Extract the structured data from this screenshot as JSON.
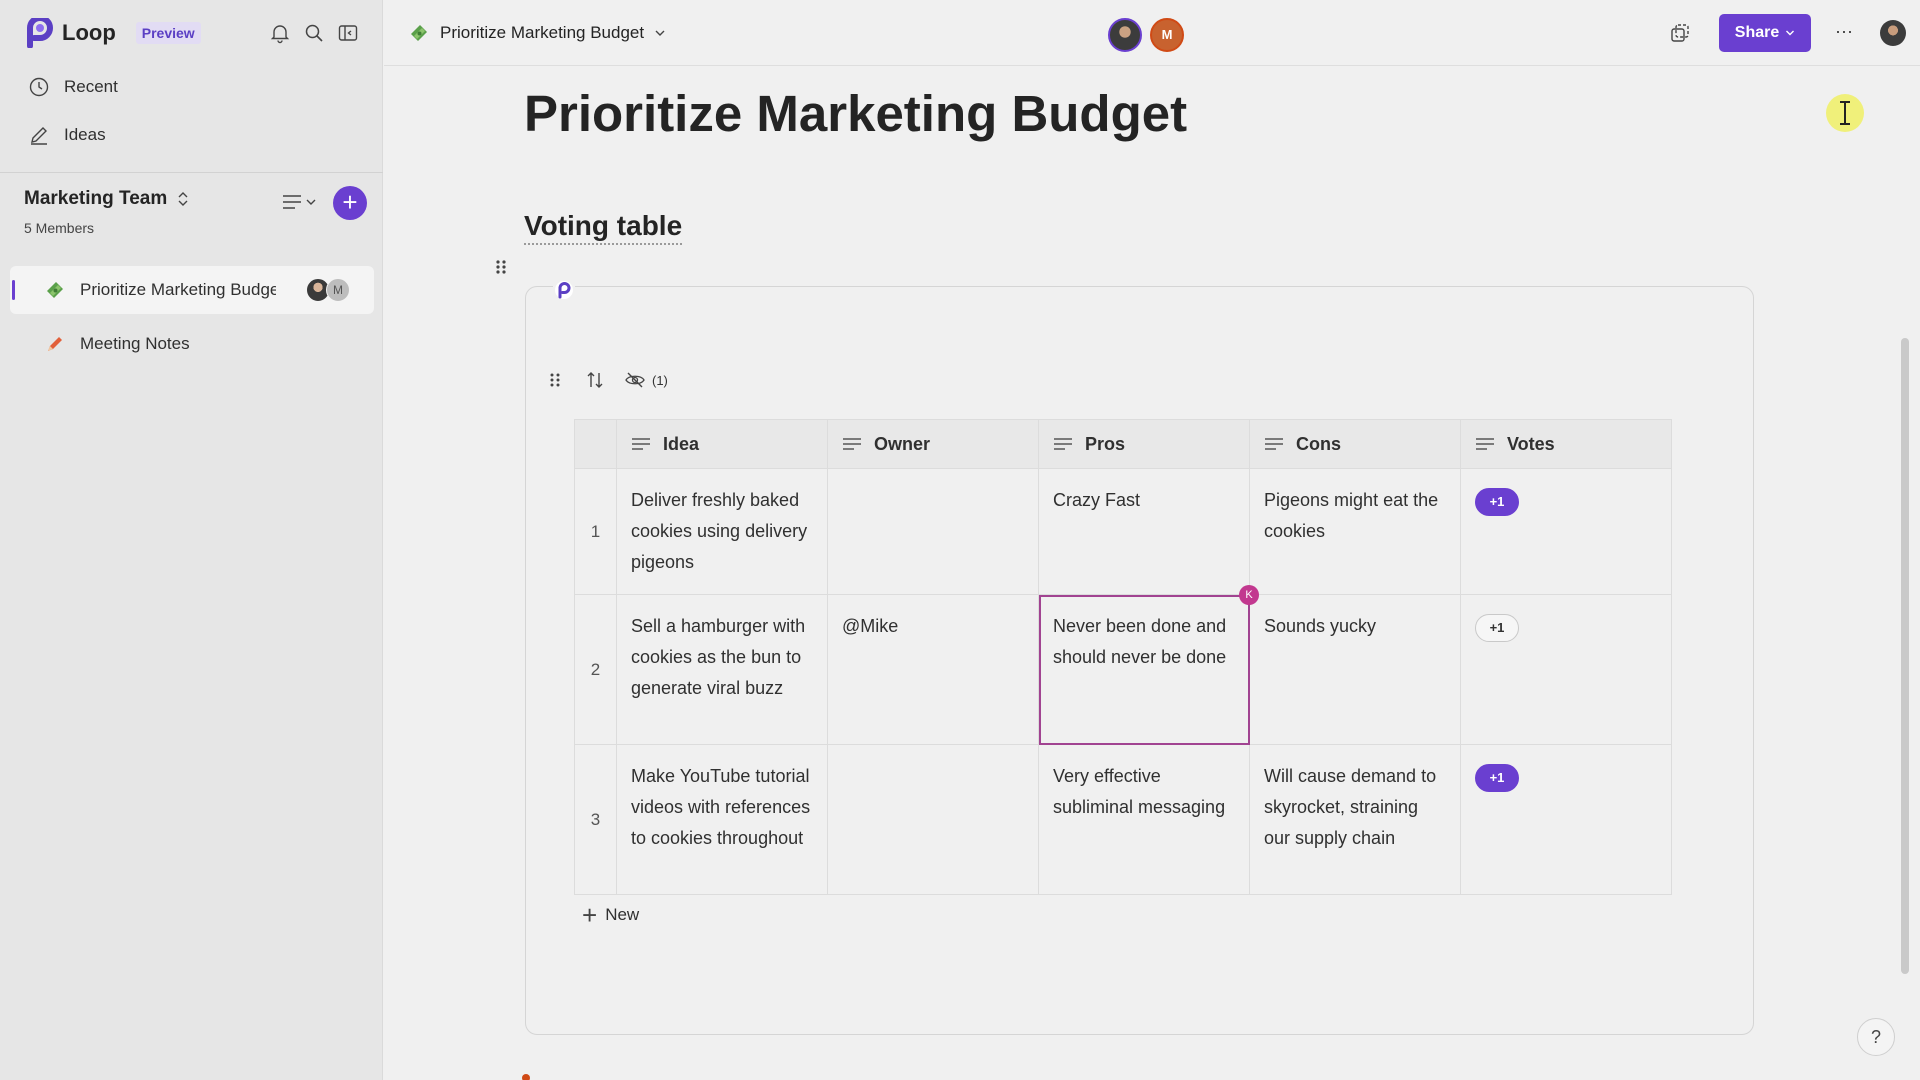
{
  "app": {
    "name": "Loop",
    "badge": "Preview"
  },
  "sidebar": {
    "nav": [
      {
        "label": "Recent",
        "icon": "clock-icon"
      },
      {
        "label": "Ideas",
        "icon": "compose-icon"
      }
    ],
    "team": {
      "name": "Marketing Team",
      "members": "5 Members"
    },
    "pages": [
      {
        "title": "Prioritize Marketing Budget",
        "icon": "money-emoji-icon",
        "active": true,
        "avatar_initial": "M"
      },
      {
        "title": "Meeting Notes",
        "icon": "pencil-emoji-icon",
        "active": false
      }
    ]
  },
  "topbar": {
    "doc_title": "Prioritize Marketing Budget",
    "presence_initial": "M",
    "share_label": "Share",
    "more_label": "···"
  },
  "page": {
    "heading": "Prioritize Marketing Budget",
    "section_heading": "Voting table",
    "hidden_columns": "(1)",
    "new_label": "New",
    "help_label": "?"
  },
  "table": {
    "columns": [
      "Idea",
      "Owner",
      "Pros",
      "Cons",
      "Votes"
    ],
    "rows": [
      {
        "num": "1",
        "idea": "Deliver freshly baked cookies using delivery pigeons",
        "owner": "",
        "pros": "Crazy Fast",
        "cons": "Pigeons might eat the cookies",
        "vote": "+1",
        "voted": true
      },
      {
        "num": "2",
        "idea": "Sell a hamburger with cookies as the bun to generate viral buzz",
        "owner": "@Mike",
        "pros": "Never been done and should never be done",
        "cons": "Sounds yucky",
        "vote": "+1",
        "voted": false,
        "editor_initial": "K"
      },
      {
        "num": "3",
        "idea": "Make YouTube tutorial videos with references to cookies throughout",
        "owner": "",
        "pros": "Very effective subliminal messaging",
        "cons": "Will cause demand to skyrocket, straining our supply chain",
        "vote": "+1",
        "voted": true
      }
    ]
  },
  "colors": {
    "accent": "#6a3fd0",
    "selection": "#a14391",
    "presence_orange": "#d04a15"
  }
}
